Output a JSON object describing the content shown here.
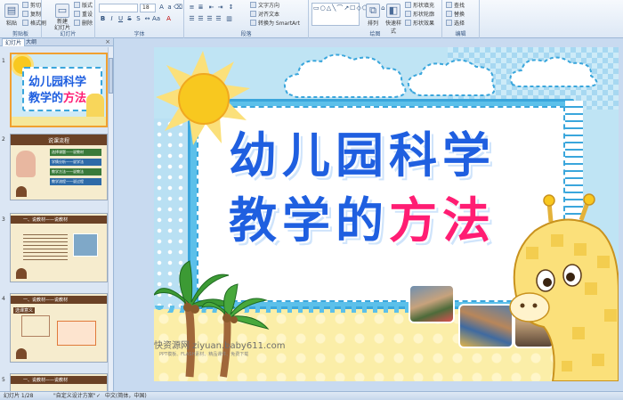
{
  "ribbon": {
    "clipboard": {
      "group": "剪贴板",
      "paste": "粘贴",
      "cut": "剪切",
      "copy": "复制",
      "format_painter": "格式刷"
    },
    "slides": {
      "group": "幻灯片",
      "new_slide": "新建\n幻灯片",
      "layout": "版式",
      "reset": "重设",
      "delete": "删除"
    },
    "font": {
      "group": "字体",
      "font_size": "18"
    },
    "paragraph": {
      "group": "段落",
      "text_direction": "文字方向",
      "align_text": "对齐文本",
      "smartart": "转换为 SmartArt"
    },
    "drawing": {
      "group": "绘图",
      "arrange": "排列",
      "quick_styles": "快速样式",
      "shape_fill": "形状填充",
      "shape_outline": "形状轮廓",
      "shape_effects": "形状效果"
    },
    "editing": {
      "group": "编辑",
      "find": "查找",
      "replace": "替换",
      "select": "选择"
    }
  },
  "left_panel": {
    "tab_slides": "幻灯片",
    "tab_outline": "大纲",
    "close": "×",
    "slide_numbers": [
      "1",
      "2",
      "3",
      "4",
      "5"
    ],
    "thumb1": {
      "line1": "幼儿园科学",
      "line2a": "教学的",
      "line2b": "方法"
    },
    "thumb2": {
      "title": "说课流程",
      "items": [
        "选择课题——说教材",
        "学情分析——说学法",
        "教学方法——说教法",
        "教学流程——说过程"
      ]
    },
    "thumb3": {
      "header": "一、说教材——说教材"
    },
    "thumb4": {
      "header": "一、说教材——说教材",
      "sub": "选课意义"
    },
    "thumb5": {
      "header": "一、说教材——说教材"
    }
  },
  "slide": {
    "title_line1": "幼儿园科学",
    "title_line2_main": "教学的",
    "title_line2_accent": "方法",
    "watermark_main": "快资源网 ziyuan.baby611.com",
    "watermark_sub": "PPT模板、FLASH素材、精品课件、免费下载"
  },
  "status": {
    "slide_info": "幻灯片 1/28",
    "theme": "\"自定义设计方案\"",
    "language": "中文(简体，中国)"
  },
  "colors": {
    "title_blue": "#1f5fe0",
    "title_pink": "#ff1d73",
    "frame_blue": "#3aa6dc",
    "sun_yellow": "#f8c81f"
  }
}
